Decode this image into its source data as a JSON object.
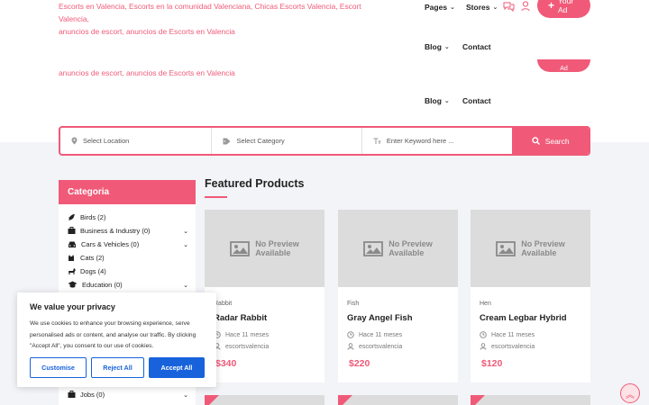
{
  "header": {
    "tagline_line1": "Escorts en Valencia, Escorts en la comunidad Valenciana, Chicas Escorts Valencia, Escort Valencia,",
    "tagline_line2": "anuncios de escort, anuncios de Escorts en Valencia",
    "tagline_line3": "anuncios de escort, anuncios de Escorts en Valencia",
    "nav_pages": "Pages",
    "nav_stores": "Stores",
    "nav_blog": "Blog",
    "nav_contact": "Contact",
    "nav_blog_2": "Blog",
    "nav_contact_2": "Contact",
    "post_button": "Your Ad",
    "post_button_2": "Ad"
  },
  "search": {
    "location_placeholder": "Select Location",
    "category_placeholder": "Select Category",
    "keyword_placeholder": "Enter Keyword here ...",
    "button_label": "Search"
  },
  "sidebar": {
    "title": "Categoria",
    "items": [
      {
        "label": "Birds (2)",
        "has_children": false
      },
      {
        "label": "Business & Industry (0)",
        "has_children": true
      },
      {
        "label": "Cars & Vehicles (0)",
        "has_children": true
      },
      {
        "label": "Cats (2)",
        "has_children": false
      },
      {
        "label": "Dogs (4)",
        "has_children": false
      },
      {
        "label": "Education (0)",
        "has_children": true
      }
    ],
    "last_item": "Jobs (0)"
  },
  "featured": {
    "title": "Featured Products",
    "no_preview_line1": "No Preview",
    "no_preview_line2": "Available",
    "cards": [
      {
        "category": "Rabbit",
        "name": "Radar Rabbit",
        "time": "Hace 11 meses",
        "author": "escortsvalencia",
        "price": "$340"
      },
      {
        "category": "Fish",
        "name": "Gray Angel Fish",
        "time": "Hace 11 meses",
        "author": "escortsvalencia",
        "price": "$220"
      },
      {
        "category": "Hen",
        "name": "Cream Legbar Hybrid",
        "time": "Hace 11 meses",
        "author": "escortsvalencia",
        "price": "$120"
      }
    ]
  },
  "cookie": {
    "title": "We value your privacy",
    "text": "We use cookies to enhance your browsing experience, serve personalised ads or content, and analyse our traffic. By clicking \"Accept All\", you consent to our use of cookies.",
    "customise": "Customise",
    "reject": "Reject All",
    "accept": "Accept All"
  },
  "colors": {
    "accent": "#f05a78",
    "cookie_blue": "#1863dc"
  }
}
